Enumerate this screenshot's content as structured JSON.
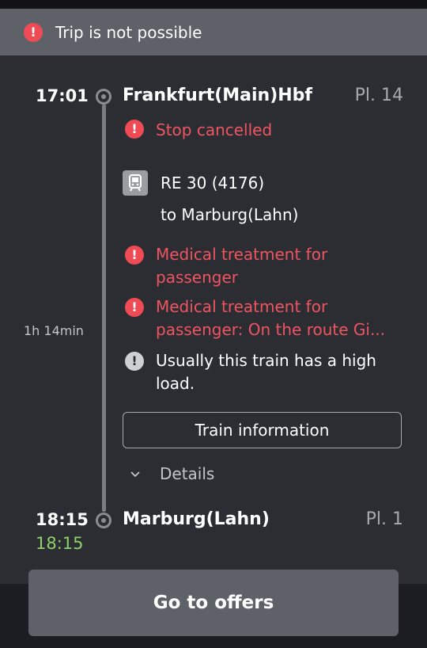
{
  "banner": {
    "text": "Trip is not possible",
    "icon": "error-icon",
    "color": "#ef4b55"
  },
  "departure": {
    "time": "17:01",
    "station": "Frankfurt(Main)Hbf",
    "platform": "Pl. 14"
  },
  "stop_status": "Stop cancelled",
  "train": {
    "icon": "train-icon",
    "name": "RE 30 (4176)",
    "destination": "to Marburg(Lahn)"
  },
  "messages": [
    {
      "type": "error",
      "text": "Medical treatment for passenger"
    },
    {
      "type": "error",
      "text": "Medical treatment for passenger: On the route Gi..."
    },
    {
      "type": "info",
      "text": "Usually this train has a high load."
    }
  ],
  "duration": "1h 14min",
  "train_info_button": "Train information",
  "details_label": "Details",
  "arrival": {
    "time": "18:15",
    "realtime": "18:15",
    "station": "Marburg(Lahn)",
    "platform": "Pl. 1"
  },
  "offers_button": "Go to offers",
  "colors": {
    "error": "#ef5560",
    "realtime": "#8fd16a",
    "background": "#2b2d33"
  }
}
